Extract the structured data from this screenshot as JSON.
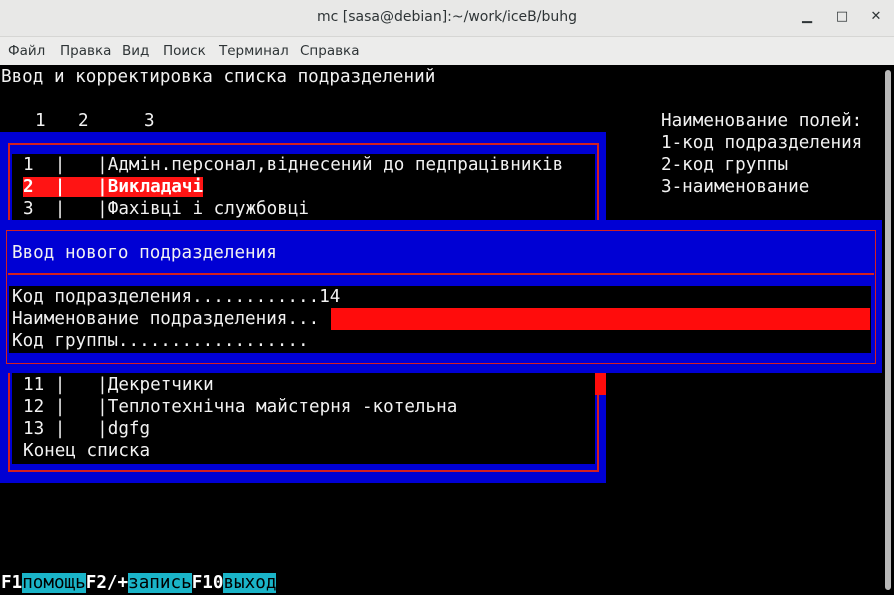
{
  "window": {
    "title": "mc [sasa@debian]:~/work/iceB/buhg",
    "minimize_icon": "minimize-icon",
    "maximize_icon": "maximize-icon",
    "close_icon": "close-icon"
  },
  "menu": [
    "Файл",
    "Правка",
    "Вид",
    "Поиск",
    "Терминал",
    "Справка"
  ],
  "screen": {
    "heading": "Ввод и корректировка списка подразделений",
    "columns": [
      "1",
      "2",
      "3"
    ],
    "legend": {
      "title": "Наименование полей:",
      "items": [
        "1-код подразделения",
        "2-код группы",
        "3-наименование"
      ]
    }
  },
  "list": {
    "rows_top": [
      {
        "code": "1",
        "group": "",
        "name": "Адмін.персонал,віднесений до педпрацівників",
        "selected": false
      },
      {
        "code": "2",
        "group": "",
        "name": "Викладачі",
        "selected": true
      },
      {
        "code": "3",
        "group": "",
        "name": "Фахівці і службовці",
        "selected": false
      }
    ],
    "rows_bottom": [
      {
        "code": "11",
        "group": "",
        "name": "Декретчики"
      },
      {
        "code": "12",
        "group": "",
        "name": "Теплотехнічна майстерня -котельна"
      },
      {
        "code": "13",
        "group": "",
        "name": "dgfg"
      }
    ],
    "end_label": "Конец списка"
  },
  "dialog": {
    "title": "Ввод нового подразделения",
    "fields": [
      {
        "label": "Код подразделения............",
        "value": "14"
      },
      {
        "label": "Наименование подразделения...",
        "value": ""
      },
      {
        "label": "Код группы..................",
        "value": ""
      }
    ]
  },
  "footer": [
    {
      "key": "F1",
      "label": "помощь"
    },
    {
      "key": "F2/+",
      "label": "запись"
    },
    {
      "key": "F10",
      "label": "выход"
    }
  ]
}
